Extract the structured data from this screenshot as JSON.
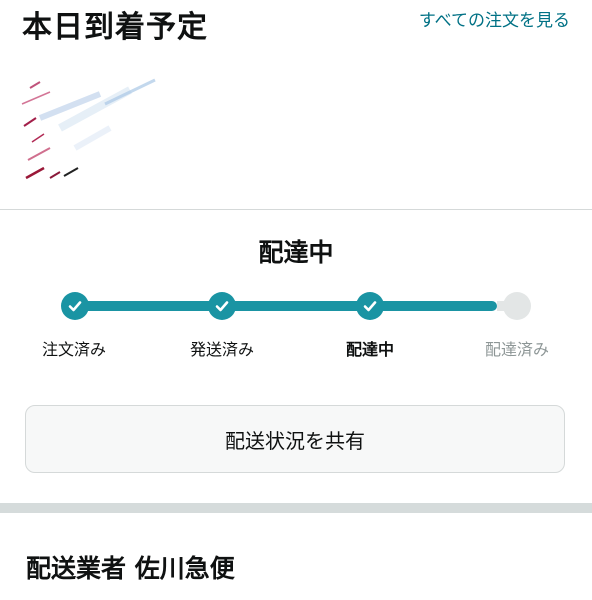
{
  "header": {
    "title": "本日到着予定",
    "all_orders_link": "すべての注文を見る"
  },
  "status": {
    "title": "配達中"
  },
  "tracker": {
    "steps": [
      {
        "label": "注文済み",
        "state": "done"
      },
      {
        "label": "発送済み",
        "state": "done"
      },
      {
        "label": "配達中",
        "state": "current"
      },
      {
        "label": "配達済み",
        "state": "pending"
      }
    ],
    "colors": {
      "done": "#1a94a3",
      "pending": "#e3e6e6"
    }
  },
  "actions": {
    "share_label": "配送状況を共有"
  },
  "carrier": {
    "label": "配送業者 佐川急便"
  }
}
